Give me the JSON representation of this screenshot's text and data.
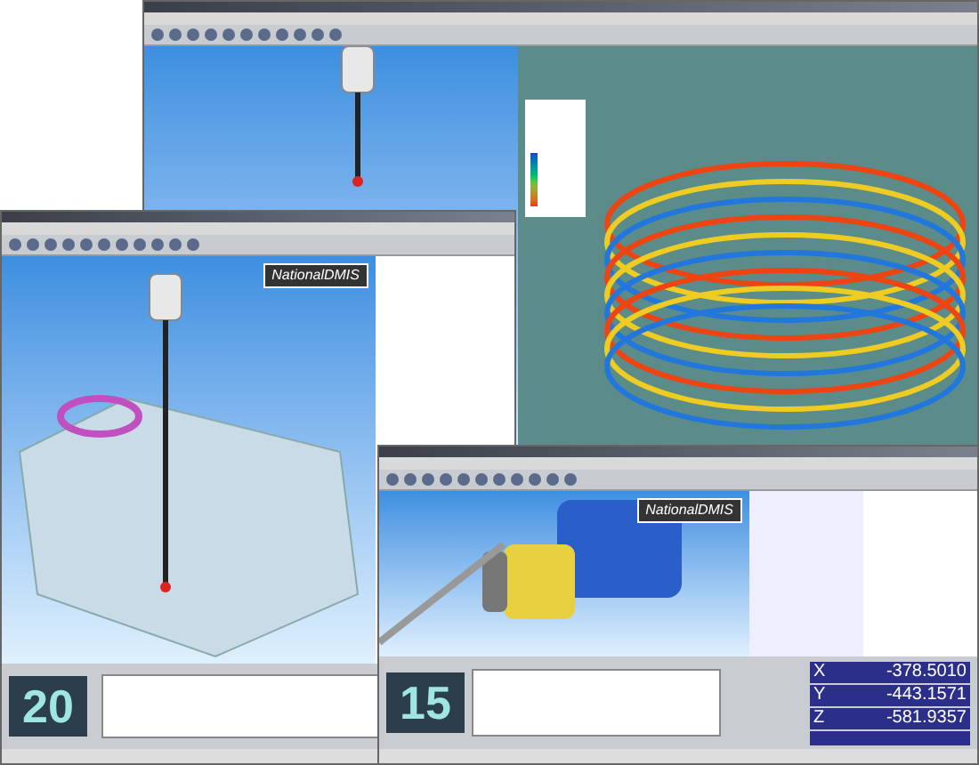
{
  "windows": [
    {
      "kind": "ring"
    },
    {
      "kind": "gearbox",
      "logo": "NationalDMIS",
      "counter": "20"
    },
    {
      "kind": "engine",
      "logo": "NationalDMIS",
      "counter": "15",
      "axes": [
        {
          "axis": "X",
          "value": "-378.5010"
        },
        {
          "axis": "Y",
          "value": "-443.1571"
        },
        {
          "axis": "Z",
          "value": "-581.9357"
        }
      ]
    }
  ]
}
